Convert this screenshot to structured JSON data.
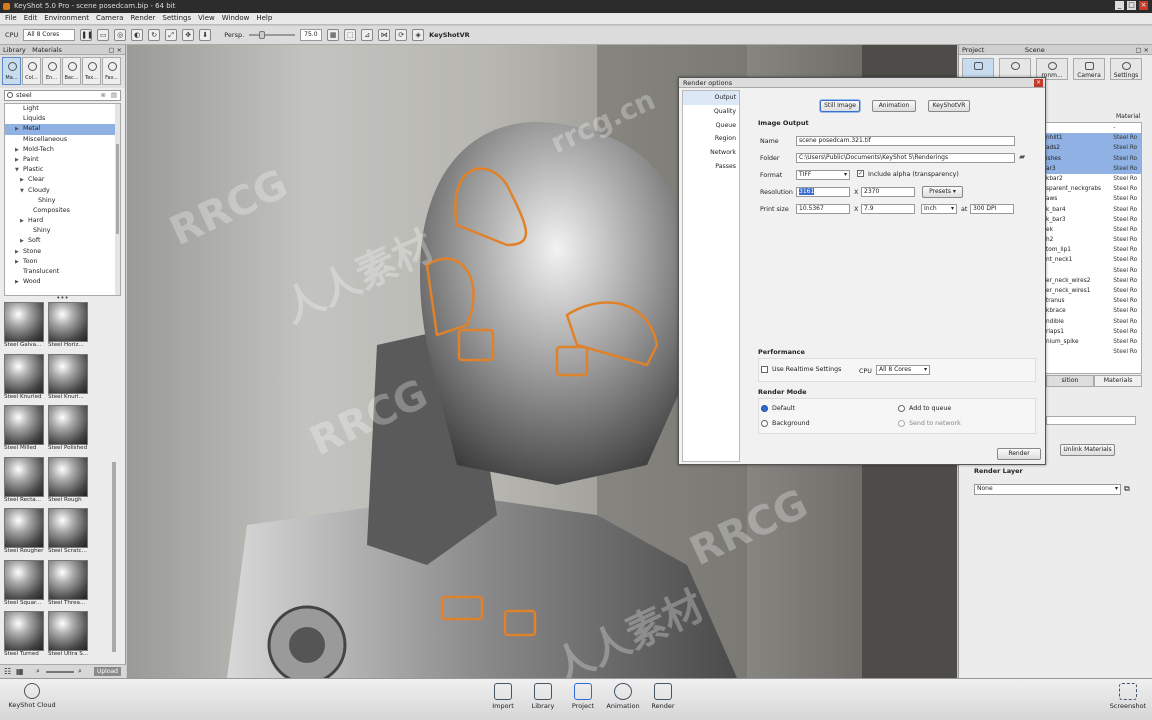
{
  "window": {
    "title": "KeyShot 5.0 Pro - scene posedcam.bip - 64 bit",
    "min": "_",
    "max": "□",
    "close": "×"
  },
  "menu": [
    "File",
    "Edit",
    "Environment",
    "Camera",
    "Render",
    "Settings",
    "View",
    "Window",
    "Help"
  ],
  "toolbar": {
    "cpu_label": "CPU",
    "cpu_value": "All 8 Cores",
    "persp_label": "Persp.",
    "persp_value": "75.0",
    "keyshotvr_label": "KeyShotVR"
  },
  "library": {
    "title": "Library",
    "panel_label": "Materials",
    "tabs": [
      "Ma...",
      "Col...",
      "En...",
      "Bac...",
      "Tex...",
      "Fav..."
    ],
    "search_value": "steel",
    "tree": [
      {
        "label": "Light",
        "indent": 2,
        "arrow": ""
      },
      {
        "label": "Liquids",
        "indent": 2,
        "arrow": ""
      },
      {
        "label": "Metal",
        "indent": 2,
        "arrow": "▶",
        "selected": true
      },
      {
        "label": "Miscellaneous",
        "indent": 2,
        "arrow": ""
      },
      {
        "label": "Mold-Tech",
        "indent": 2,
        "arrow": "▶"
      },
      {
        "label": "Paint",
        "indent": 2,
        "arrow": "▶"
      },
      {
        "label": "Plastic",
        "indent": 2,
        "arrow": "▼"
      },
      {
        "label": "Clear",
        "indent": 3,
        "arrow": "▶"
      },
      {
        "label": "Cloudy",
        "indent": 3,
        "arrow": "▼"
      },
      {
        "label": "Shiny",
        "indent": 5,
        "arrow": ""
      },
      {
        "label": "Composites",
        "indent": 4,
        "arrow": ""
      },
      {
        "label": "Hard",
        "indent": 3,
        "arrow": "▶"
      },
      {
        "label": "Shiny",
        "indent": 4,
        "arrow": ""
      },
      {
        "label": "Soft",
        "indent": 3,
        "arrow": "▶"
      },
      {
        "label": "Stone",
        "indent": 2,
        "arrow": "▶"
      },
      {
        "label": "Toon",
        "indent": 2,
        "arrow": "▶"
      },
      {
        "label": "Translucent",
        "indent": 2,
        "arrow": ""
      },
      {
        "label": "Wood",
        "indent": 2,
        "arrow": "▶"
      }
    ],
    "thumbnails": [
      "Steel Galva...",
      "Steel Horiz...",
      "Steel Knurled",
      "Steel Knurl...",
      "Steel Milled",
      "Steel Polished",
      "Steel Recta...",
      "Steel Rough",
      "Steel Rougher",
      "Steel Scratc...",
      "Steel Squar...",
      "Steel Threa...",
      "Steel Turned",
      "Steel Ultra S..."
    ],
    "upload_label": "Upload"
  },
  "render_options": {
    "title": "Render options",
    "close": "×",
    "nav": [
      "Output",
      "Quality",
      "Queue",
      "Region",
      "Network",
      "Passes"
    ],
    "buttons": {
      "still": "Still Image",
      "animation": "Animation",
      "keyshotvr": "KeyShotVR"
    },
    "image_output": "Image Output",
    "name_label": "Name",
    "name_value": "scene posedcam.321.tif",
    "folder_label": "Folder",
    "folder_value": "C:\\Users\\Public\\Documents\\KeyShot 5\\Renderings",
    "format_label": "Format",
    "format_value": "TIFF",
    "alpha_label": "Include alpha (transparency)",
    "resolution_label": "Resolution",
    "res_w": "3161",
    "res_x": "X",
    "res_h": "2370",
    "presets": "Presets",
    "print_label": "Print size",
    "print_w": "10.5367",
    "print_x": "X",
    "print_h": "7.9",
    "unit": "Inch",
    "at": "at",
    "dpi": "300 DPI",
    "performance": "Performance",
    "realtime_label": "Use Realtime Settings",
    "cpu_label": "CPU",
    "cpu_value": "All 8 Cores",
    "render_mode": "Render Mode",
    "default": "Default",
    "add_queue": "Add to queue",
    "background": "Background",
    "send_network": "Send to network",
    "render_button": "Render"
  },
  "scene": {
    "project_label": "Project",
    "scene_label": "Scene",
    "tabs": [
      "",
      "",
      "ronm...",
      "Camera",
      "Settings"
    ],
    "material_header": "Material",
    "dash": "-",
    "rows": [
      {
        "a": "",
        "b": "-",
        "sel": false
      },
      {
        "a": "nhilt1",
        "b": "Steel Ro",
        "sel": true
      },
      {
        "a": "ads2",
        "b": "Steel Ro",
        "sel": true
      },
      {
        "a": "ishes",
        "b": "Steel Ro",
        "sel": true
      },
      {
        "a": "ar3",
        "b": "Steel Ro",
        "sel": true
      },
      {
        "a": "kbar2",
        "b": "Steel Ro",
        "sel": false
      },
      {
        "a": "sparent_neckgrabs",
        "b": "Steel Ro",
        "sel": false
      },
      {
        "a": "aws",
        "b": "Steel Ro",
        "sel": false
      },
      {
        "a": "k_bar4",
        "b": "Steel Ro",
        "sel": false
      },
      {
        "a": "k_bar3",
        "b": "Steel Ro",
        "sel": false
      },
      {
        "a": "ek",
        "b": "Steel Ro",
        "sel": false
      },
      {
        "a": "h2",
        "b": "Steel Ro",
        "sel": false
      },
      {
        "a": "tom_lip1",
        "b": "Steel Ro",
        "sel": false
      },
      {
        "a": "nt_neck1",
        "b": "Steel Ro",
        "sel": false
      },
      {
        "a": "",
        "b": "Steel Ro",
        "sel": false
      },
      {
        "a": "er_neck_wires2",
        "b": "Steel Ro",
        "sel": false
      },
      {
        "a": "er_neck_wires1",
        "b": "Steel Ro",
        "sel": false
      },
      {
        "a": "tranus",
        "b": "Steel Ro",
        "sel": false
      },
      {
        "a": "kbrace",
        "b": "Steel Ro",
        "sel": false
      },
      {
        "a": "ndible",
        "b": "Steel Ro",
        "sel": false
      },
      {
        "a": "rlaps1",
        "b": "Steel Ro",
        "sel": false
      },
      {
        "a": "nium_spike",
        "b": "Steel Ro",
        "sel": false
      },
      {
        "a": "",
        "b": "Steel Ro",
        "sel": false
      }
    ],
    "subtab_position": "sition",
    "subtab_materials": "Materials",
    "unlink": "Unlink Materials",
    "render_layer": "Render Layer",
    "layer_value": "None"
  },
  "bottom": {
    "cloud": "KeyShot Cloud",
    "items": [
      "Import",
      "Library",
      "Project",
      "Animation",
      "Render"
    ],
    "screenshot": "Screenshot"
  },
  "watermarks": [
    "RRCG",
    "人人素材",
    "rrcg.cn"
  ]
}
